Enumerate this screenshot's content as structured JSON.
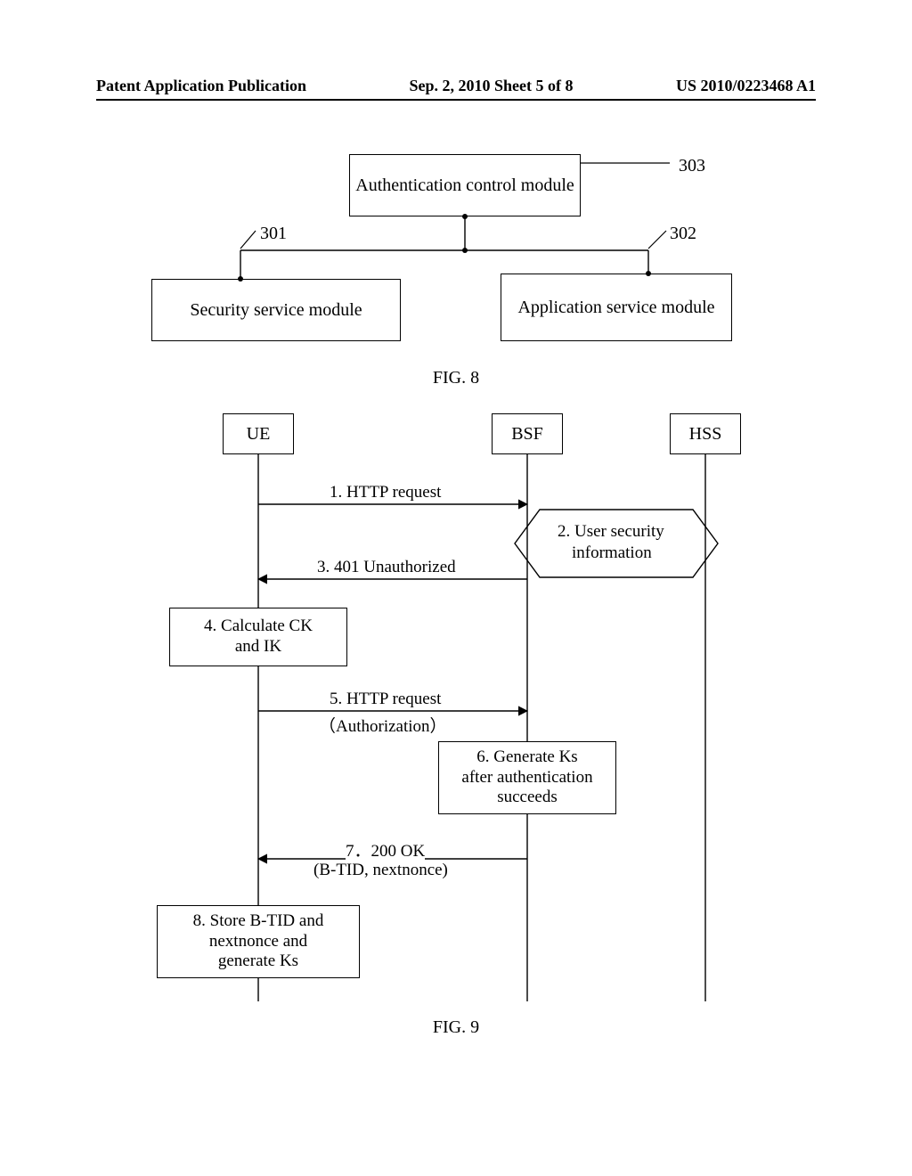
{
  "header": {
    "left": "Patent Application Publication",
    "center": "Sep. 2, 2010  Sheet 5 of 8",
    "right": "US 2010/0223468 A1"
  },
  "fig8": {
    "caption": "FIG. 8",
    "box303": "Authentication control module",
    "box301": "Security service module",
    "box302": "Application service module",
    "lbl303": "303",
    "lbl301": "301",
    "lbl302": "302"
  },
  "fig9": {
    "caption": "FIG. 9",
    "ue": "UE",
    "bsf": "BSF",
    "hss": "HSS",
    "msg1": "1. HTTP request",
    "msg2_l1": "2. User security",
    "msg2_l2": "information",
    "msg3": "3. 401 Unauthorized",
    "box4_l1": "4. Calculate CK",
    "box4_l2": "and IK",
    "msg5_l1": "5. HTTP request",
    "msg5_l2": "（Authorization）",
    "box6_l1": "6. Generate Ks",
    "box6_l2": "after authentication",
    "box6_l3": "succeeds",
    "msg7_l1": "7．200 OK",
    "msg7_l2": "(B-TID, nextnonce)",
    "box8_l1": "8. Store B-TID and",
    "box8_l2": "nextnonce and",
    "box8_l3": "generate Ks"
  }
}
